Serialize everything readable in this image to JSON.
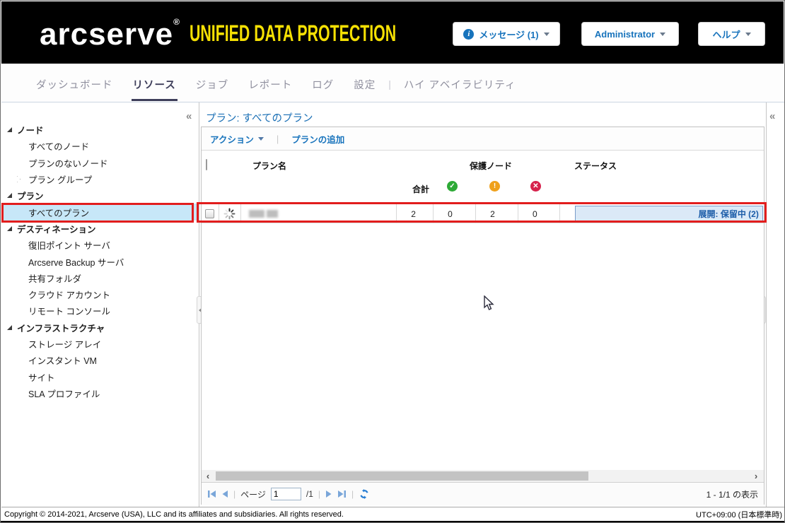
{
  "header": {
    "logo": "arcserve",
    "logo_mark": "®",
    "product": "UNIFIED DATA PROTECTION",
    "messages_button": "メッセージ (1)",
    "user_button": "Administrator",
    "help_button": "ヘルプ",
    "info_glyph": "i"
  },
  "nav": {
    "separator": "|",
    "tabs": [
      {
        "label": "ダッシュボード",
        "active": false
      },
      {
        "label": "リソース",
        "active": true
      },
      {
        "label": "ジョブ",
        "active": false
      },
      {
        "label": "レポート",
        "active": false
      },
      {
        "label": "ログ",
        "active": false
      },
      {
        "label": "設定",
        "active": false
      },
      {
        "label": "ハイ アベイラビリティ",
        "active": false
      }
    ]
  },
  "sidebar": {
    "groups": [
      {
        "label": "ノード",
        "items": [
          "すべてのノード",
          "プランのないノード",
          "プラン グループ"
        ]
      },
      {
        "label": "プラン",
        "items": [
          "すべてのプラン"
        ]
      },
      {
        "label": "デスティネーション",
        "items": [
          "復旧ポイント サーバ",
          "Arcserve Backup サーバ",
          "共有フォルダ",
          "クラウド アカウント",
          "リモート コンソール"
        ]
      },
      {
        "label": "インフラストラクチャ",
        "items": [
          "ストレージ アレイ",
          "インスタント VM",
          "サイト",
          "SLA プロファイル"
        ]
      }
    ],
    "selected_item": "すべてのプラン"
  },
  "main": {
    "collapse_glyph": "«",
    "title": "プラン: すべてのプラン",
    "toolbar": {
      "actions_label": "アクション",
      "add_plan_label": "プランの追加"
    },
    "table": {
      "col_plan_name": "プラン名",
      "col_protected_nodes": "保護ノード",
      "col_status": "ステータス",
      "col_total": "合計",
      "ok_glyph": "✓",
      "warn_glyph": "!",
      "err_glyph": "✕",
      "row": {
        "total": "2",
        "ok": "0",
        "warn": "2",
        "error": "0",
        "status": "展開: 保留中 (2)"
      }
    },
    "scrollbar": {
      "left_glyph": "‹",
      "right_glyph": "›"
    },
    "pager": {
      "page_label": "ページ",
      "page_value": "1",
      "page_of": "/1",
      "separator": "|",
      "range_text": "1 - 1/1 の表示"
    }
  },
  "footer": {
    "copyright": "Copyright © 2014-2021, Arcserve (USA), LLC and its affiliates and subsidiaries. All rights reserved.",
    "timezone": "UTC+09:00 (日本標準時)"
  },
  "colors": {
    "brand_yellow": "#f5e003",
    "link_blue": "#1773bc",
    "status_ok_green": "#2daa36",
    "status_warn_orange": "#efa11c",
    "status_err_red": "#d6224c",
    "annotation_red": "#e21d1d",
    "selected_row_blue": "#c7e7f8",
    "status_box_bg": "#dbe9f7"
  }
}
